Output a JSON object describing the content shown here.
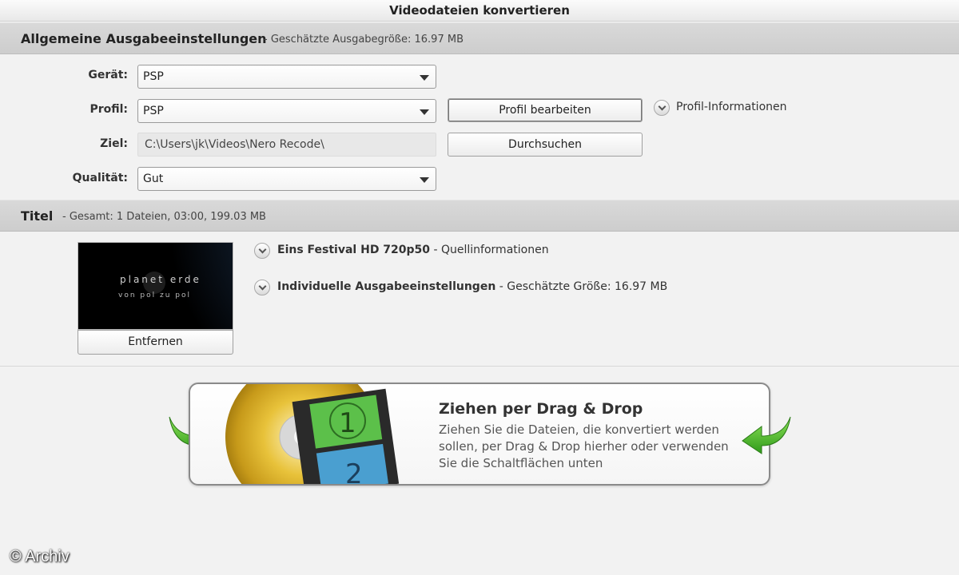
{
  "window": {
    "title": "Videodateien konvertieren"
  },
  "general": {
    "heading": "Allgemeine Ausgabeeinstellungen",
    "subtitle": "- Geschätzte Ausgabegröße:   16.97 MB",
    "device_label": "Gerät:",
    "device_value": "PSP",
    "profile_label": "Profil:",
    "profile_value": "PSP",
    "edit_profile_button": "Profil bearbeiten",
    "profile_info_label": "Profil-Informationen",
    "target_label": "Ziel:",
    "target_path": "C:\\Users\\jk\\Videos\\Nero Recode\\",
    "browse_button": "Durchsuchen",
    "quality_label": "Qualität:",
    "quality_value": "Gut"
  },
  "titles": {
    "heading": "Titel",
    "summary": "- Gesamt: 1 Dateien, 03:00, 199.03 MB",
    "item": {
      "thumbnail_text_line1": "planet erde",
      "thumbnail_text_line2": "von pol zu pol",
      "source_name": "Eins Festival HD 720p50",
      "source_suffix": " - Quellinformationen",
      "individual_name": "Individuelle Ausgabeeinstellungen",
      "individual_suffix": " - Geschätzte Größe: 16.97 MB",
      "remove_button": "Entfernen"
    }
  },
  "dropzone": {
    "title": "Ziehen per Drag & Drop",
    "description": "Ziehen Sie die Dateien, die konvertiert werden sollen, per Drag & Drop hierher oder verwenden Sie die Schaltflächen unten",
    "film_numbers": [
      "1",
      "2"
    ]
  },
  "watermark": "© Archiv",
  "colors": {
    "accent_green": "#4caf2a",
    "disc_gold": "#e8c23a",
    "section_bar": "#d3d3d3"
  },
  "icons": [
    "chevron-down-icon",
    "circle-chevron-icon",
    "green-arrow-icon",
    "disc-icon",
    "film-strip-icon"
  ]
}
